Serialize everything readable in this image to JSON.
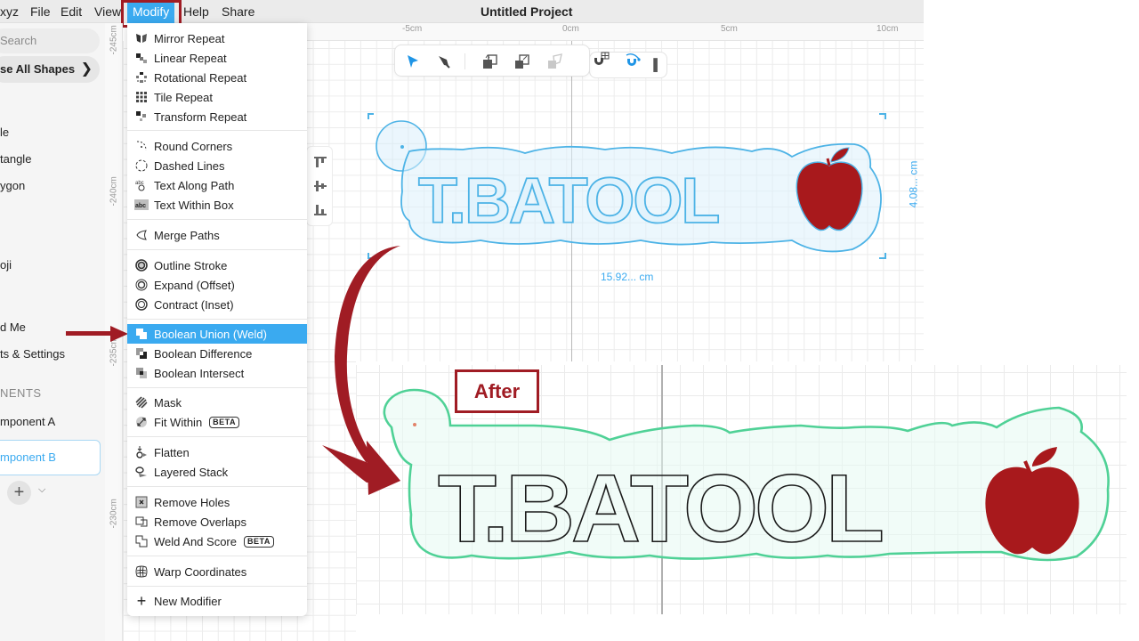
{
  "menubar": {
    "app_name_partial": "xyz",
    "items": [
      "File",
      "Edit",
      "View",
      "Modify",
      "Help",
      "Share"
    ],
    "active_item": "Modify",
    "title": "Untitled Project"
  },
  "sidebar": {
    "search_placeholder": "Search",
    "browse_label": "se All Shapes",
    "items": [
      "le",
      "tangle",
      "ygon",
      "oji",
      "d Me",
      "ts & Settings"
    ],
    "components_heading": "NENTS",
    "components": [
      {
        "label": "mponent A",
        "selected": false
      },
      {
        "label": "mponent B",
        "selected": true
      }
    ]
  },
  "rulers": {
    "horizontal": [
      "-5cm",
      "0cm",
      "5cm",
      "10cm"
    ],
    "vertical": [
      "-245cm",
      "-240cm",
      "-235cm",
      "-230cm"
    ]
  },
  "toolbar": {
    "tools": [
      {
        "name": "select",
        "active": true
      },
      {
        "name": "pen",
        "active": false
      },
      {
        "name": "bring-forward",
        "active": false
      },
      {
        "name": "send-backward",
        "active": false
      },
      {
        "name": "transform",
        "active": false,
        "disabled": true
      },
      {
        "name": "snap-grid",
        "active": false
      },
      {
        "name": "snap-path",
        "active": true
      }
    ]
  },
  "modify_menu": {
    "groups": [
      [
        {
          "label": "Mirror Repeat",
          "icon": "mirror-repeat-icon"
        },
        {
          "label": "Linear Repeat",
          "icon": "linear-repeat-icon"
        },
        {
          "label": "Rotational Repeat",
          "icon": "rotational-repeat-icon"
        },
        {
          "label": "Tile Repeat",
          "icon": "tile-repeat-icon"
        },
        {
          "label": "Transform Repeat",
          "icon": "transform-repeat-icon"
        }
      ],
      [
        {
          "label": "Round Corners",
          "icon": "round-corners-icon"
        },
        {
          "label": "Dashed Lines",
          "icon": "dashed-lines-icon"
        },
        {
          "label": "Text Along Path",
          "icon": "text-along-path-icon"
        },
        {
          "label": "Text Within Box",
          "icon": "text-within-box-icon"
        }
      ],
      [
        {
          "label": "Merge Paths",
          "icon": "merge-paths-icon"
        }
      ],
      [
        {
          "label": "Outline Stroke",
          "icon": "outline-stroke-icon"
        },
        {
          "label": "Expand (Offset)",
          "icon": "expand-offset-icon"
        },
        {
          "label": "Contract (Inset)",
          "icon": "contract-inset-icon"
        }
      ],
      [
        {
          "label": "Boolean Union (Weld)",
          "icon": "boolean-union-icon",
          "highlighted": true
        },
        {
          "label": "Boolean Difference",
          "icon": "boolean-difference-icon"
        },
        {
          "label": "Boolean Intersect",
          "icon": "boolean-intersect-icon"
        }
      ],
      [
        {
          "label": "Mask",
          "icon": "mask-icon"
        },
        {
          "label": "Fit Within",
          "icon": "fit-within-icon",
          "badge": "BETA"
        }
      ],
      [
        {
          "label": "Flatten",
          "icon": "flatten-icon"
        },
        {
          "label": "Layered Stack",
          "icon": "layered-stack-icon"
        }
      ],
      [
        {
          "label": "Remove Holes",
          "icon": "remove-holes-icon"
        },
        {
          "label": "Remove Overlaps",
          "icon": "remove-overlaps-icon"
        },
        {
          "label": "Weld And Score",
          "icon": "weld-and-score-icon",
          "badge": "BETA"
        }
      ],
      [
        {
          "label": "Warp Coordinates",
          "icon": "warp-coordinates-icon"
        }
      ],
      [
        {
          "label": "New Modifier",
          "icon": "plus-icon"
        }
      ]
    ]
  },
  "canvas": {
    "before_text": "T.BATOOL",
    "selection_width": "15.92... cm",
    "selection_height": "4.08... cm",
    "after_label": "After",
    "after_text": "T.BATOOL"
  },
  "colors": {
    "accent": "#3aaaf0",
    "annotation": "#a01c24",
    "apple": "#a8191c",
    "weld_outline": "#4fd196",
    "selection": "#4db3e6"
  }
}
